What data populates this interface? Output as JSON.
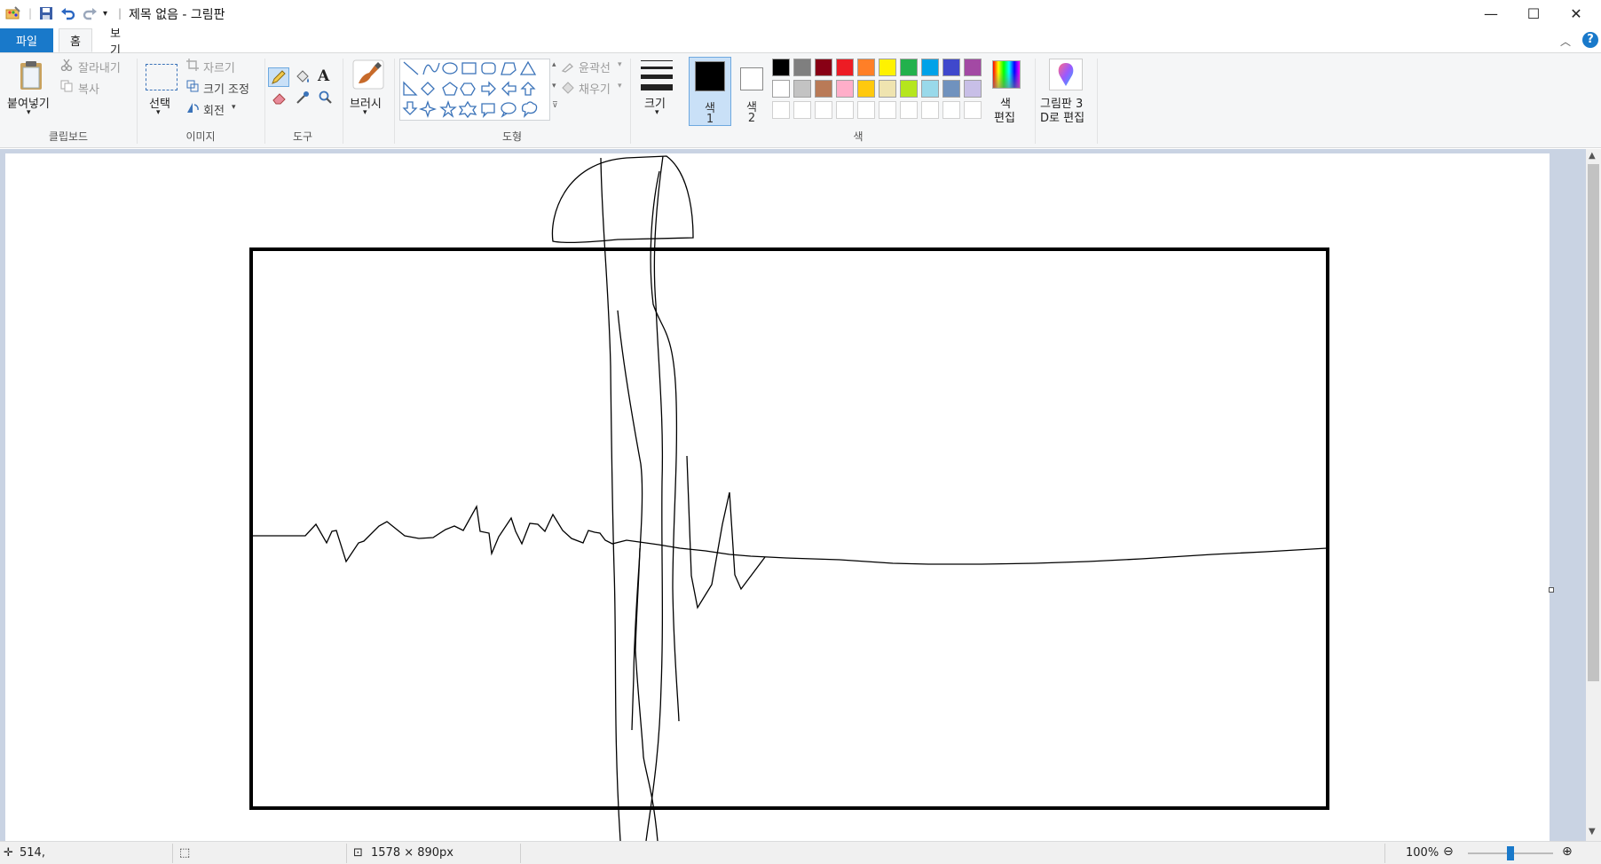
{
  "window": {
    "title": "제목 없음 - 그림판",
    "minimize": "—",
    "maximize": "☐",
    "close": "✕"
  },
  "tabs": [
    {
      "label": "파일"
    },
    {
      "label": "홈"
    },
    {
      "label": "보기"
    }
  ],
  "ribbon": {
    "clipboard": {
      "paste": "붙여넣기",
      "cut": "잘라내기",
      "copy": "복사",
      "group": "클립보드"
    },
    "image": {
      "select": "선택",
      "crop": "자르기",
      "resize": "크기 조정",
      "rotate": "회전",
      "group": "이미지"
    },
    "tools": {
      "group": "도구"
    },
    "brushes": {
      "label": "브러시"
    },
    "shapes": {
      "outline": "윤곽선",
      "fill": "채우기",
      "group": "도형"
    },
    "size": {
      "label": "크기"
    },
    "colors": {
      "color1_a": "색",
      "color1_b": "1",
      "color2_a": "색",
      "color2_b": "2",
      "edit_a": "색",
      "edit_b": "편집",
      "group": "색",
      "palette_row1": [
        "#000000",
        "#7f7f7f",
        "#880015",
        "#ed1c24",
        "#ff7f27",
        "#fff200",
        "#22b14c",
        "#00a2e8",
        "#3f48cc",
        "#a349a4"
      ],
      "palette_row2": [
        "#ffffff",
        "#c3c3c3",
        "#b97a57",
        "#ffaec9",
        "#ffc90e",
        "#efe4b0",
        "#b5e61d",
        "#99d9ea",
        "#7092be",
        "#c8bfe7"
      ],
      "color1": "#000000",
      "color2": "#ffffff"
    },
    "paint3d": {
      "line1": "그림판 3",
      "line2": "D로 편집"
    }
  },
  "status": {
    "cursor": "514,",
    "canvas_size": "1578 × 890px",
    "zoom": "100%",
    "zoom_level": 0.5
  }
}
